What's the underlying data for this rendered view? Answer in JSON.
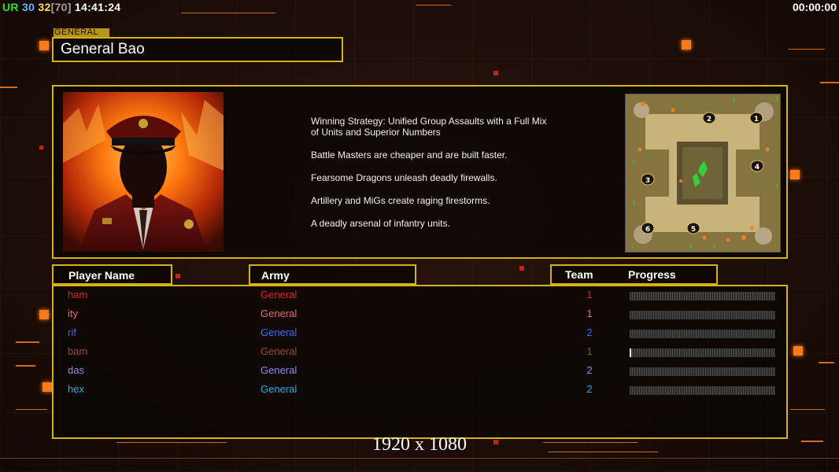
{
  "topbar": {
    "ur_label": "UR",
    "val1": "30",
    "val2": "32",
    "bracket": "[70]",
    "time": "14:41:24",
    "timer": "00:00:00"
  },
  "general": {
    "tag": "GENERAL",
    "name": "General Bao",
    "description": [
      "Winning Strategy: Unified Group Assaults with a Full Mix of Units and Superior Numbers",
      "Battle Masters are cheaper and are built faster.",
      "Fearsome Dragons unleash deadly firewalls.",
      "Artillery and MiGs create raging firestorms.",
      "A deadly arsenal of infantry units."
    ]
  },
  "minimap": {
    "start_positions": [
      "1",
      "2",
      "3",
      "4",
      "5",
      "6"
    ]
  },
  "table": {
    "headers": {
      "name": "Player Name",
      "army": "Army",
      "team": "Team",
      "progress": "Progress"
    },
    "players": [
      {
        "name": "ham",
        "army": "General",
        "team": "1",
        "color": "#e02020",
        "progress": 0
      },
      {
        "name": "ity",
        "army": "General",
        "team": "1",
        "color": "#e07060",
        "progress": 0
      },
      {
        "name": "rif",
        "army": "General",
        "team": "2",
        "color": "#3c6cf0",
        "progress": 0
      },
      {
        "name": "bam",
        "army": "General",
        "team": "1",
        "color": "#9a4a2a",
        "progress": 0.01
      },
      {
        "name": "das",
        "army": "General",
        "team": "2",
        "color": "#8c8cf0",
        "progress": 0
      },
      {
        "name": "hex",
        "army": "General",
        "team": "2",
        "color": "#30a8e0",
        "progress": 0
      }
    ]
  },
  "resolution_label": "1920 x 1080",
  "colors": {
    "frame": "#d6b21a",
    "accent": "#ff7a1a"
  }
}
